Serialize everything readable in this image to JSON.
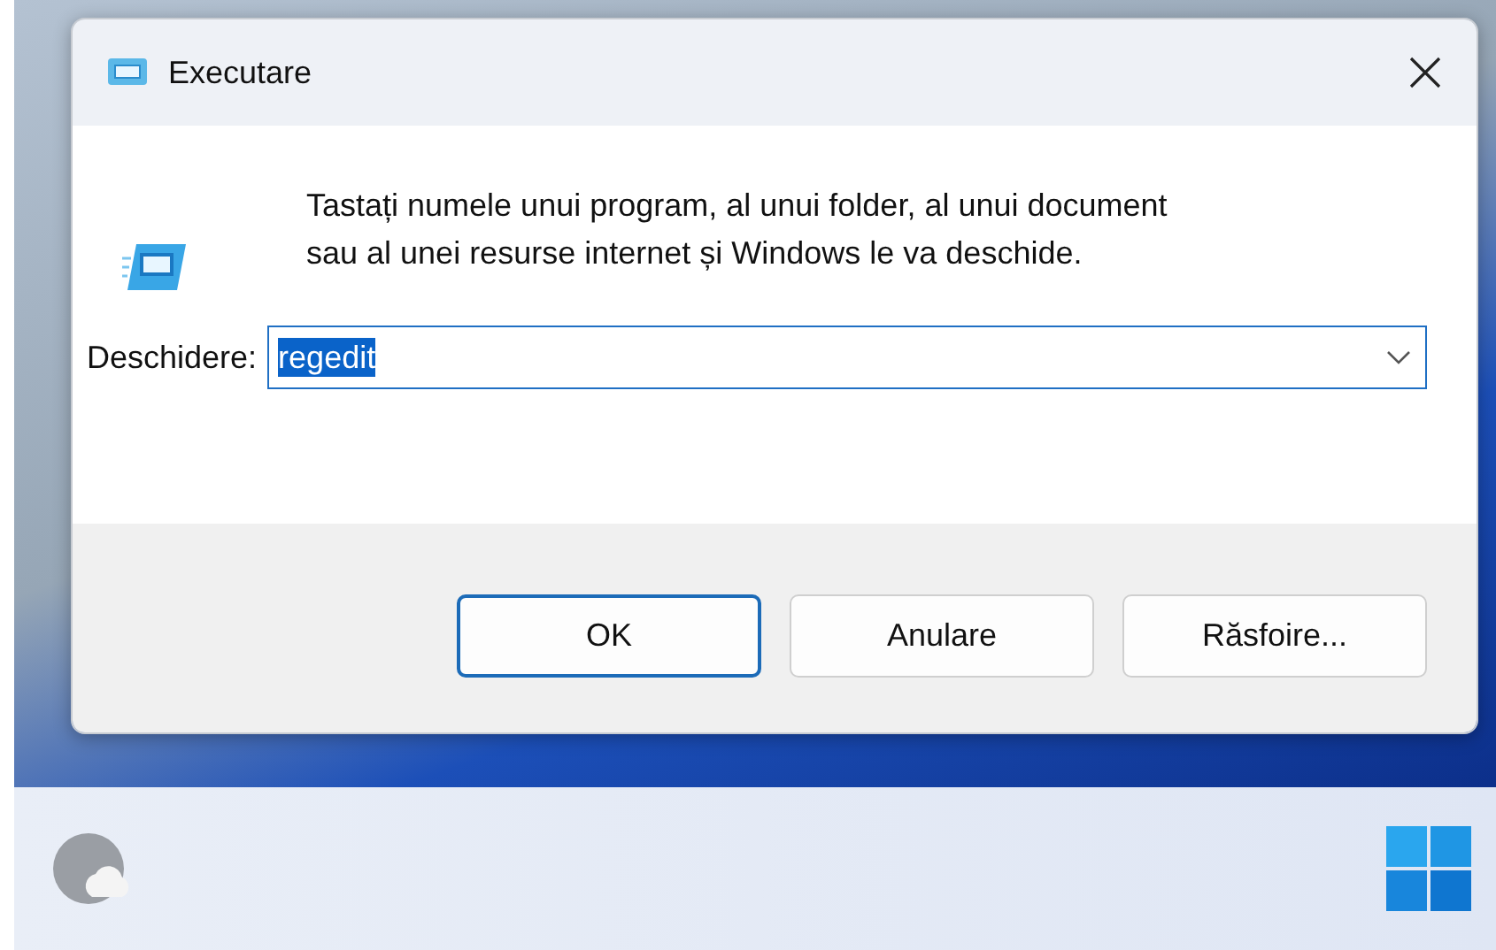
{
  "window": {
    "title": "Executare"
  },
  "message": "Tastați numele unui program, al unui folder, al unui document sau al unei resurse internet și Windows le va deschide.",
  "open_field": {
    "label": "Deschidere:",
    "value": "regedit",
    "text_selected": true
  },
  "buttons": [
    {
      "label": "OK",
      "default": true
    },
    {
      "label": "Anulare",
      "default": false
    },
    {
      "label": "Răsfoire...",
      "default": false
    }
  ]
}
